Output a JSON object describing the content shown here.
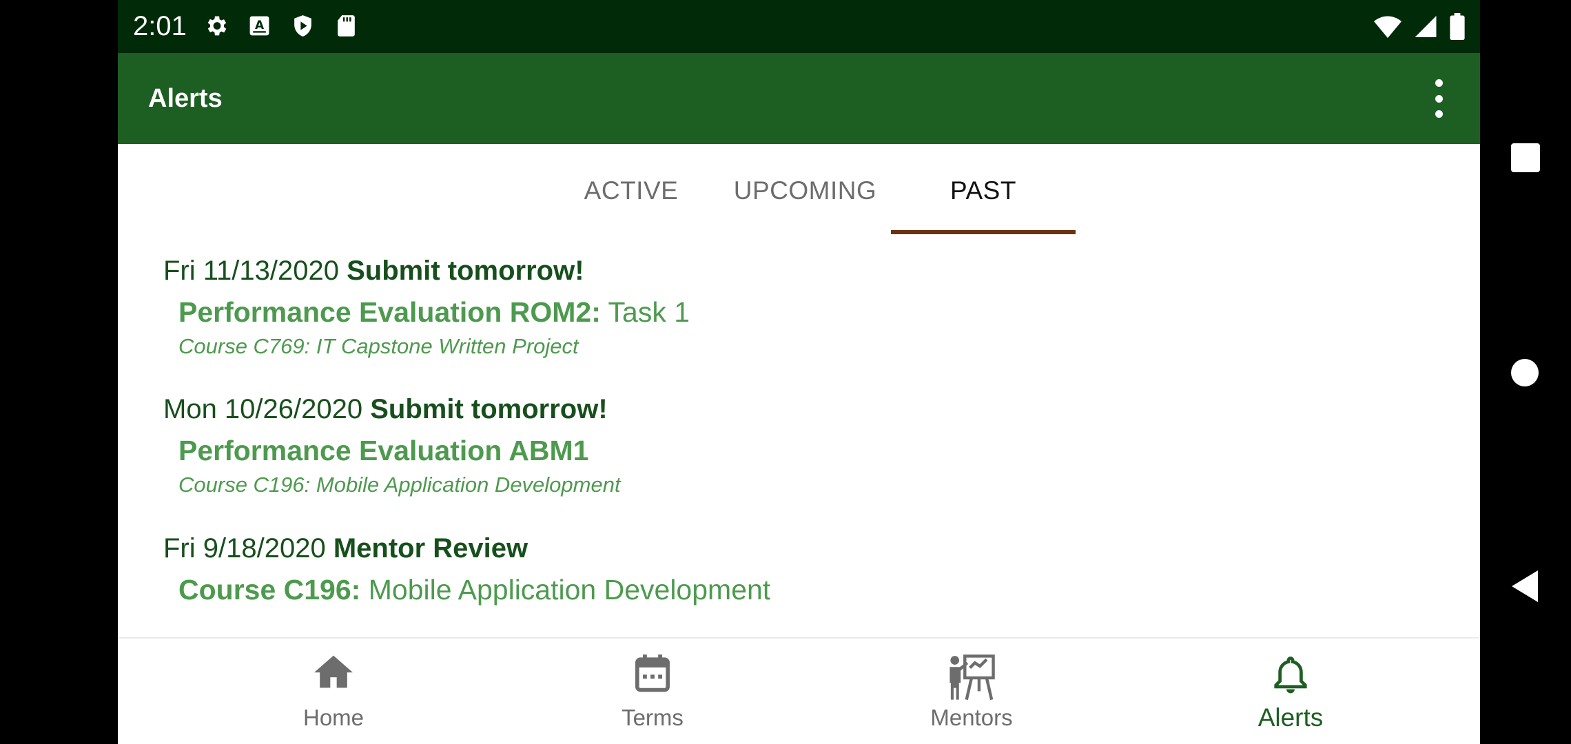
{
  "status_bar": {
    "time": "2:01",
    "left_icons": [
      "settings-icon",
      "a-notification-icon",
      "play-protect-icon",
      "sd-card-icon"
    ],
    "right_icons": [
      "wifi-icon",
      "signal-icon",
      "battery-icon"
    ]
  },
  "app_bar": {
    "title": "Alerts",
    "overflow_icon": "more-vert-icon"
  },
  "tabs": [
    {
      "label": "ACTIVE",
      "active": false
    },
    {
      "label": "UPCOMING",
      "active": false
    },
    {
      "label": "PAST",
      "active": true
    }
  ],
  "alerts": [
    {
      "date": "Fri 11/13/2020",
      "kind": "Submit tomorrow!",
      "title_bold": "Performance Evaluation ROM2:",
      "title_rest": "Task 1",
      "subtitle": "Course C769: IT Capstone Written Project"
    },
    {
      "date": "Mon 10/26/2020",
      "kind": "Submit tomorrow!",
      "title_bold": "Performance Evaluation ABM1",
      "title_rest": "",
      "subtitle": "Course C196: Mobile Application Development"
    },
    {
      "date": "Fri 9/18/2020",
      "kind": "Mentor Review",
      "title_bold": "Course C196:",
      "title_rest": "Mobile Application Development",
      "subtitle": ""
    }
  ],
  "bottom_nav": [
    {
      "label": "Home",
      "icon": "home-icon",
      "active": false
    },
    {
      "label": "Terms",
      "icon": "calendar-icon",
      "active": false
    },
    {
      "label": "Mentors",
      "icon": "teacher-icon",
      "active": false
    },
    {
      "label": "Alerts",
      "icon": "bell-icon",
      "active": true
    }
  ],
  "system_nav": [
    "recents-button",
    "home-button",
    "back-button"
  ],
  "colors": {
    "status_bar": "#012a08",
    "app_bar": "#1d5e22",
    "tab_indicator": "#6b3212",
    "header_text": "#174f1c",
    "title_text": "#4d9a4e"
  }
}
